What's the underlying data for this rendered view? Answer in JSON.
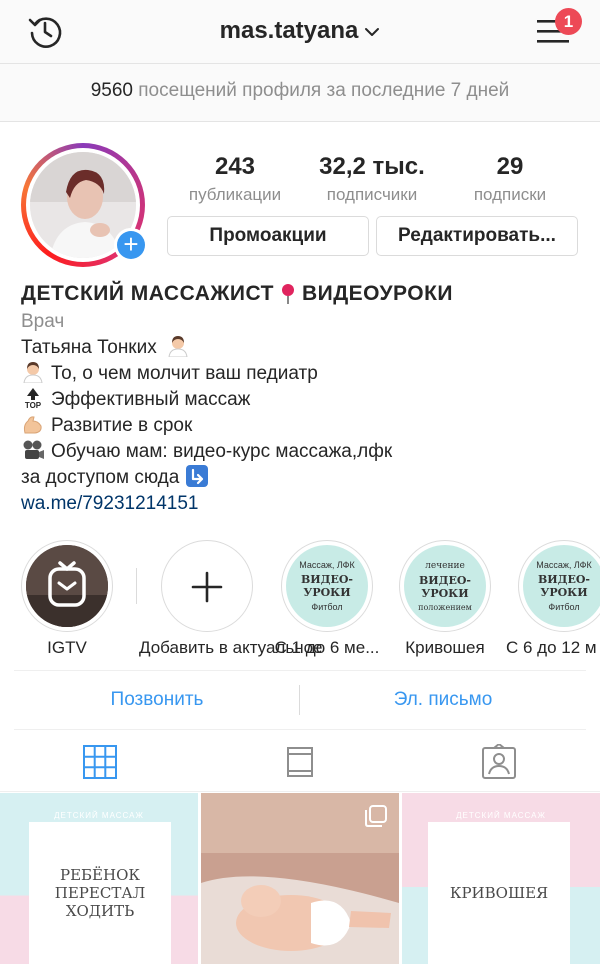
{
  "header": {
    "username": "mas.tatyana",
    "notification_count": "1",
    "icons": [
      "history-icon",
      "chevron-down-icon",
      "menu-icon"
    ]
  },
  "visits": {
    "count": "9560",
    "text": "посещений профиля за последние 7 дней"
  },
  "stats": [
    {
      "value": "243",
      "label": "публикации"
    },
    {
      "value": "32,2 тыс.",
      "label": "подписчики"
    },
    {
      "value": "29",
      "label": "подписки"
    }
  ],
  "buttons": {
    "promo": "Промоакции",
    "edit": "Редактировать..."
  },
  "bio": {
    "title": "ДЕТСКИЙ МАССАЖИСТ",
    "title_suffix": "ВИДЕОУРОКИ",
    "category": "Врач",
    "name_line": "Татьяна Тонких",
    "lines": [
      "То, о чем молчит ваш педиатр",
      "Эффективный массаж",
      "Развитие в срок",
      "Обучаю мам: видео-курс массажа,лфк"
    ],
    "access_line": "за доступом сюда",
    "link": "wa.me/79231214151"
  },
  "highlights": [
    {
      "label": "IGTV"
    },
    {
      "label": "Добавить в актуальное"
    },
    {
      "label": "С 1 до 6 ме...",
      "top": "Массаж, ЛФК",
      "main": "ВИДЕО-УРОКИ",
      "bottom": "Фитбол"
    },
    {
      "label": "Кривошея",
      "top": "лечение",
      "main": "ВИДЕО-УРОКИ",
      "bottom": "положением"
    },
    {
      "label": "С 6 до 12 м",
      "top": "Массаж, ЛФК",
      "main": "ВИДЕО-УРОКИ",
      "bottom": "Фитбол"
    }
  ],
  "contact": {
    "call": "Позвонить",
    "email": "Эл. письмо"
  },
  "tabs": [
    "grid-icon",
    "igtv-tab-icon",
    "tagged-icon"
  ],
  "posts": [
    {
      "header": "ДЕТСКИЙ МАССАЖ",
      "text": "РЕБЁНОК ПЕРЕСТАЛ ХОДИТЬ"
    },
    {
      "type": "photo"
    },
    {
      "header": "ДЕТСКИЙ МАССАЖ",
      "text": "КРИВОШЕЯ"
    }
  ],
  "colors": {
    "accent_blue": "#3897f0",
    "badge_red": "#ed4956",
    "muted": "#8e8e8e",
    "link": "#003569"
  }
}
